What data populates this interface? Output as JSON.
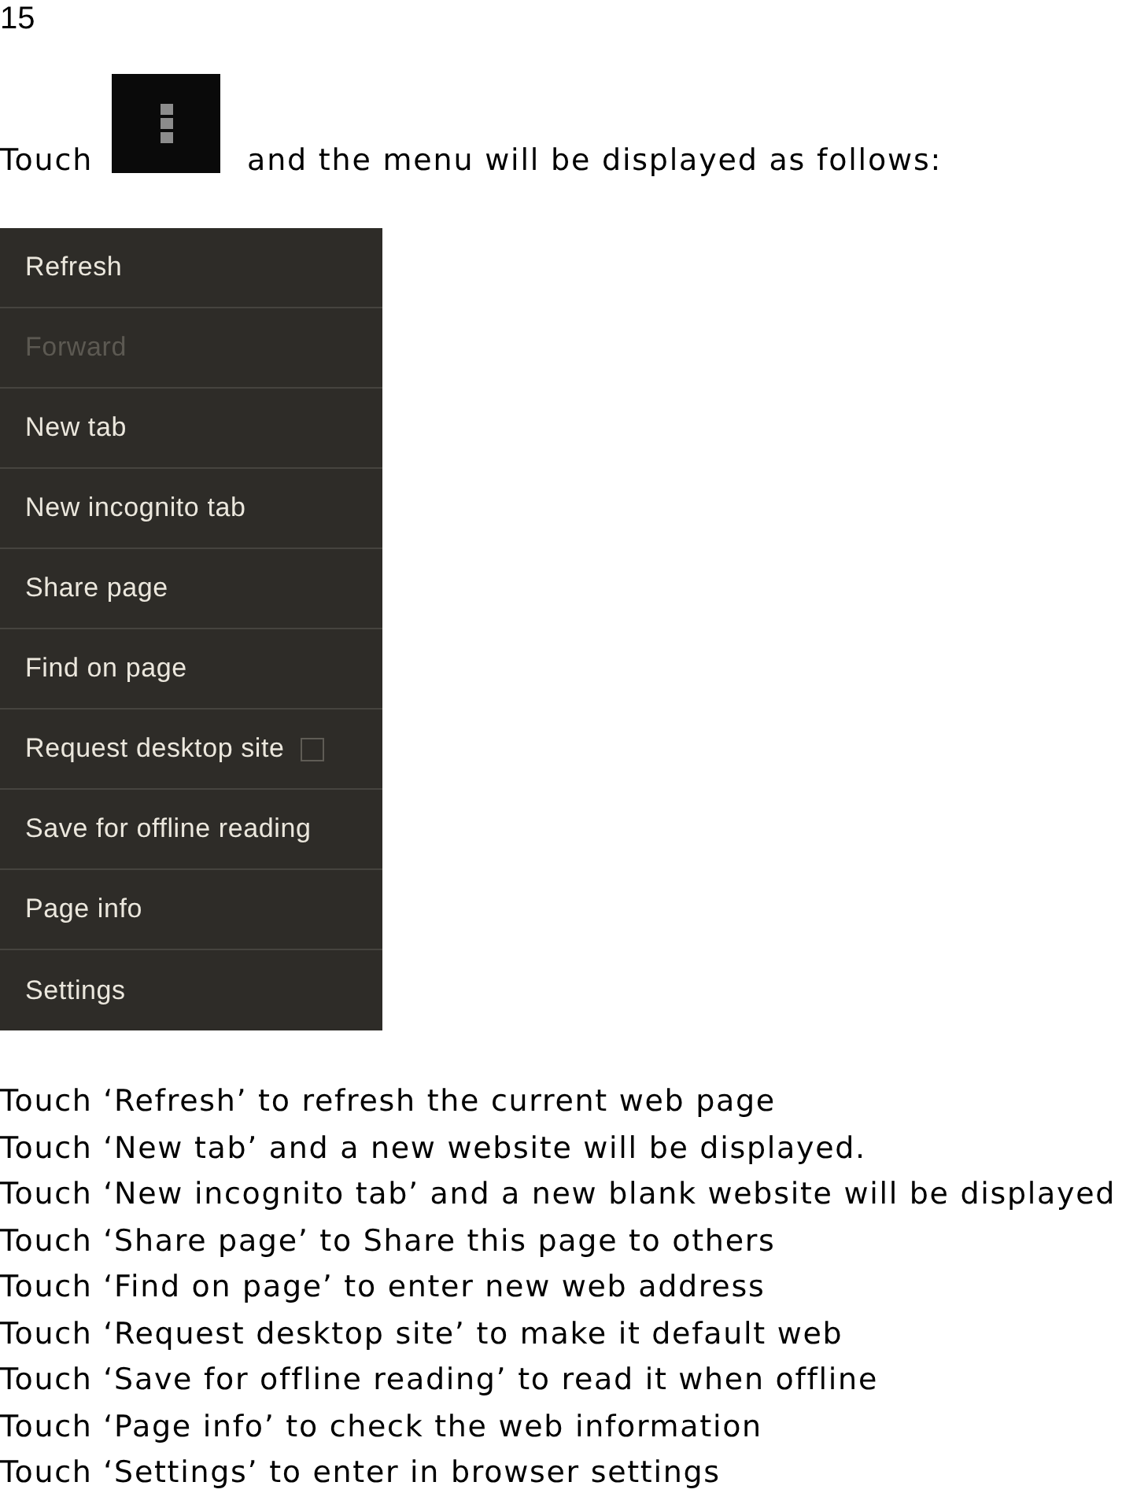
{
  "page_number": "15",
  "intro": {
    "before": "Touch",
    "after": "and the menu will be displayed as follows:"
  },
  "menu": {
    "items": [
      {
        "kind": "plain",
        "label": "Refresh",
        "disabled": false
      },
      {
        "kind": "plain",
        "label": "Forward",
        "disabled": true
      },
      {
        "kind": "plain",
        "label": "New tab",
        "disabled": false
      },
      {
        "kind": "plain",
        "label": "New incognito tab",
        "disabled": false
      },
      {
        "kind": "plain",
        "label": "Share page",
        "disabled": false
      },
      {
        "kind": "plain",
        "label": "Find on page",
        "disabled": false
      },
      {
        "kind": "checkbox",
        "label": "Request desktop site",
        "disabled": false,
        "checked": false
      },
      {
        "kind": "plain",
        "label": "Save for offline reading",
        "disabled": false
      },
      {
        "kind": "plain",
        "label": "Page info",
        "disabled": false
      },
      {
        "kind": "plain",
        "label": "Settings",
        "disabled": false
      }
    ]
  },
  "instructions": [
    "Touch ‘Refresh’ to refresh the current web page",
    "Touch ‘New tab’ and a new website will be displayed.",
    "Touch ‘New incognito tab’ and a new blank website will be displayed",
    "Touch ‘Share page’ to Share this page to others",
    "Touch ‘Find on page’ to enter new web address",
    "Touch ‘Request desktop site’ to make it default web",
    "Touch ‘Save for offline reading’ to read it when offline",
    "Touch ‘Page info’ to check the web information",
    "Touch ‘Settings’ to enter in browser settings"
  ]
}
